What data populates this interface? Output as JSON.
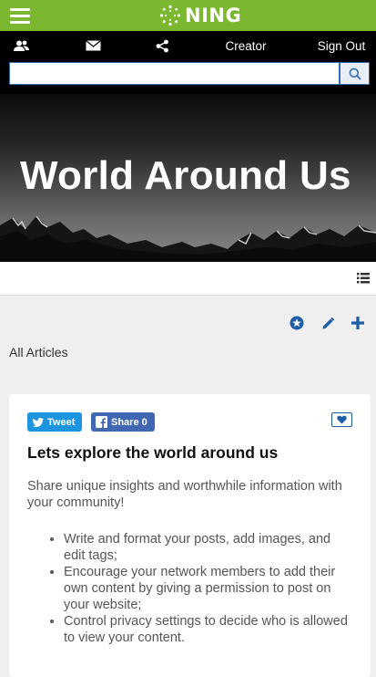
{
  "brand": {
    "logo_text": "NING"
  },
  "nav": {
    "creator_label": "Creator",
    "signout_label": "Sign Out"
  },
  "search": {
    "value": "",
    "placeholder": ""
  },
  "hero": {
    "title": "World Around Us"
  },
  "section": {
    "heading": "All Articles"
  },
  "card": {
    "tweet_label": "Tweet",
    "share_label": "Share 0",
    "title": "Lets explore the world around us",
    "intro": "Share unique insights and worthwhile information with your community!",
    "bullets": [
      "Write and format your posts, add images, and edit tags;",
      "Encourage your network members to add their own content by giving a permission to post on your website;",
      "Control privacy settings to decide who is allowed to view your content."
    ]
  },
  "colors": {
    "topbar": "#7cb82f",
    "navbar": "#000000",
    "accent": "#1e5ea8",
    "tweet": "#1b95e0",
    "facebook": "#4267b2"
  }
}
